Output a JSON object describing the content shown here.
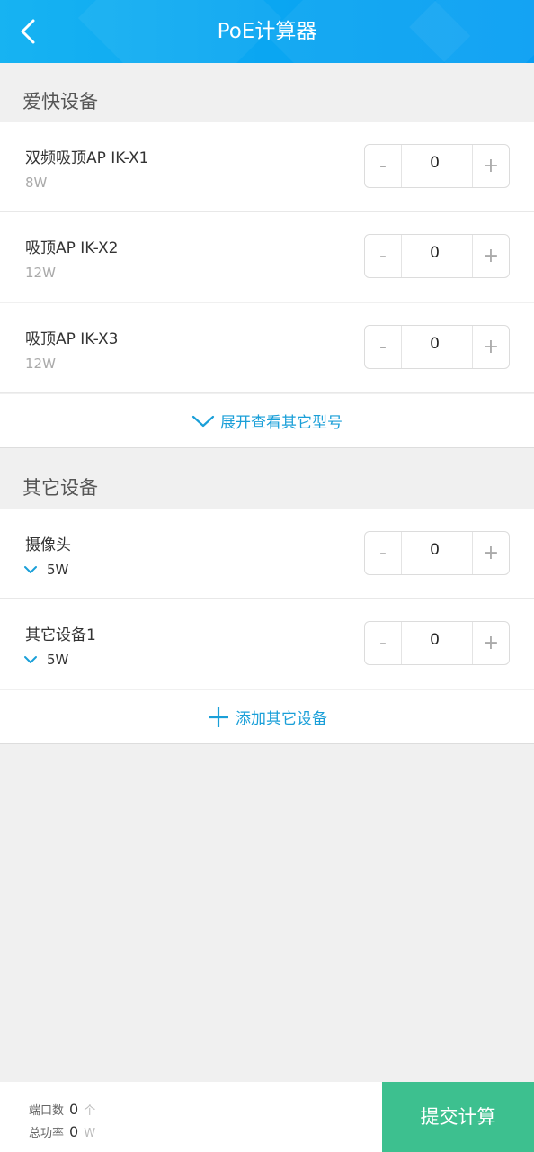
{
  "header": {
    "title": "PoE计算器"
  },
  "sections": {
    "brand_title": "爱快设备",
    "other_title": "其它设备"
  },
  "brand_devices": [
    {
      "name": "双频吸顶AP IK-X1",
      "watt": "8W",
      "count": "0"
    },
    {
      "name": "吸顶AP IK-X2",
      "watt": "12W",
      "count": "0"
    },
    {
      "name": "吸顶AP IK-X3",
      "watt": "12W",
      "count": "0"
    }
  ],
  "expand_label": "展开查看其它型号",
  "other_devices": [
    {
      "name": "摄像头",
      "watt": "5W",
      "count": "0"
    },
    {
      "name": "其它设备1",
      "watt": "5W",
      "count": "0"
    }
  ],
  "add_label": "添加其它设备",
  "stepper": {
    "minus": "-",
    "plus": "+"
  },
  "footer": {
    "ports_label": "端口数",
    "ports_value": "0",
    "ports_unit": "个",
    "power_label": "总功率",
    "power_value": "0",
    "power_unit": "W",
    "submit_label": "提交计算"
  },
  "colors": {
    "header": "#0aa6f2",
    "accent": "#1a9fd8",
    "submit": "#3dc08f"
  }
}
